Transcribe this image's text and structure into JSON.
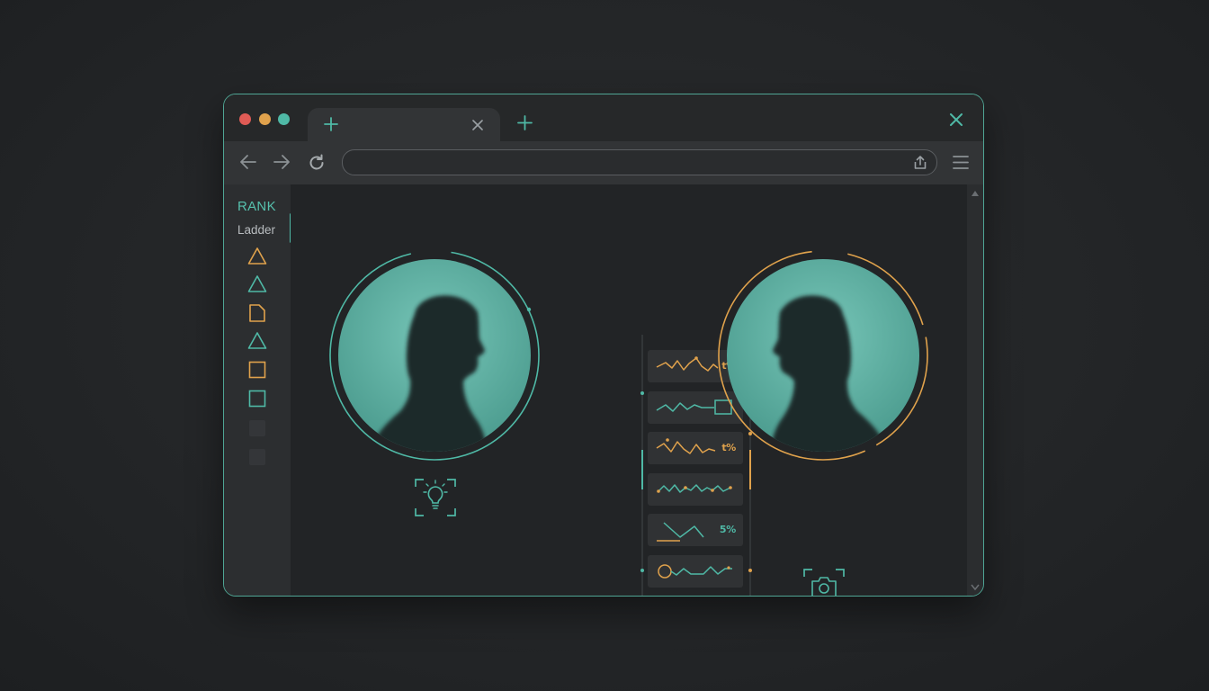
{
  "colors": {
    "accent_teal": "#4fb9a6",
    "accent_orange": "#e0a24c",
    "close_red": "#df5b55",
    "frame": "#4fa594"
  },
  "window": {
    "controls": [
      "close-dot",
      "minimize-dot",
      "maximize-dot"
    ],
    "tab": {
      "icons": [
        "plus-icon",
        "close-icon"
      ]
    },
    "new_tab_icon": "plus-icon",
    "window_close_icon": "close-icon"
  },
  "toolbar": {
    "back_icon": "arrow-left-icon",
    "forward_icon": "arrow-right-icon",
    "reload_icon": "reload-icon",
    "address": {
      "value": "",
      "placeholder": ""
    },
    "share_icon": "share-icon",
    "menu_icon": "hamburger-icon"
  },
  "sidebar": {
    "title": "RANK",
    "subtitle": "Ladder",
    "items": [
      {
        "icon": "triangle-icon",
        "color": "#e0a24c"
      },
      {
        "icon": "triangle-icon",
        "color": "#4fb9a6"
      },
      {
        "icon": "document-icon",
        "color": "#e0a24c"
      },
      {
        "icon": "triangle-icon",
        "color": "#4fb9a6"
      },
      {
        "icon": "square-icon",
        "color": "#e0a24c"
      },
      {
        "icon": "square-icon",
        "color": "#4fb9a6"
      },
      {
        "icon": "empty-slot",
        "color": "#343639"
      },
      {
        "icon": "empty-slot",
        "color": "#343639"
      }
    ]
  },
  "players": [
    {
      "side": "left",
      "ring_color": "#4fb9a6",
      "badge_icon": "lightbulb-icon"
    },
    {
      "side": "right",
      "ring_color": "#e0a24c",
      "badge_icon": "camera-icon"
    }
  ],
  "metrics": [
    {
      "label": "t%",
      "color": "#e0a24c"
    },
    {
      "label": "",
      "color": "#4fb9a6"
    },
    {
      "label": "t%",
      "color": "#e0a24c"
    },
    {
      "label": "",
      "color": "#4fb9a6"
    },
    {
      "label": "5%",
      "color": "#4fb9a6"
    },
    {
      "label": "",
      "color": "#4fb9a6"
    },
    {
      "label": "",
      "color": "#e0a24c"
    }
  ]
}
